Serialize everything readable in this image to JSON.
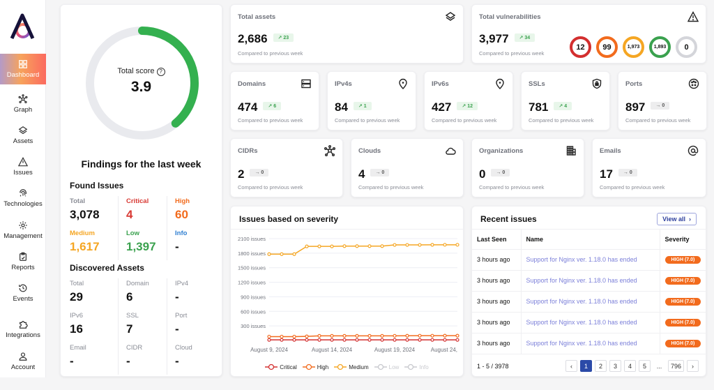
{
  "sidebar": {
    "items": [
      {
        "label": "Dashboard",
        "icon": "dashboard-icon",
        "active": true
      },
      {
        "label": "Graph",
        "icon": "graph-icon"
      },
      {
        "label": "Assets",
        "icon": "layers-icon"
      },
      {
        "label": "Issues",
        "icon": "warning-icon"
      },
      {
        "label": "Technologies",
        "icon": "fingerprint-icon"
      },
      {
        "label": "Management",
        "icon": "gear-icon"
      },
      {
        "label": "Reports",
        "icon": "clipboard-icon"
      },
      {
        "label": "Events",
        "icon": "history-icon"
      },
      {
        "label": "Integrations",
        "icon": "puzzle-icon"
      },
      {
        "label": "Account",
        "icon": "user-icon"
      }
    ]
  },
  "score": {
    "label": "Total score",
    "value": "3.9",
    "fraction": 0.39,
    "color": "#34b04f"
  },
  "findings": {
    "title": "Findings for the last week",
    "found_issues": {
      "title": "Found Issues",
      "cells": [
        {
          "label": "Total",
          "value": "3,078",
          "color": "#8a8d96",
          "valcolor": "#111111"
        },
        {
          "label": "Critical",
          "value": "4",
          "color": "#d83a34",
          "valcolor": "#d83a34"
        },
        {
          "label": "High",
          "value": "60",
          "color": "#f26b1d",
          "valcolor": "#f26b1d"
        },
        {
          "label": "Medium",
          "value": "1,617",
          "color": "#f5a623",
          "valcolor": "#f5a623"
        },
        {
          "label": "Low",
          "value": "1,397",
          "color": "#3aa14e",
          "valcolor": "#3aa14e"
        },
        {
          "label": "Info",
          "value": "-",
          "color": "#2f7fd1",
          "valcolor": "#111111"
        }
      ]
    },
    "discovered_assets": {
      "title": "Discovered Assets",
      "cells": [
        {
          "label": "Total",
          "value": "29"
        },
        {
          "label": "Domain",
          "value": "6"
        },
        {
          "label": "IPv4",
          "value": "-"
        },
        {
          "label": "IPv6",
          "value": "16"
        },
        {
          "label": "SSL",
          "value": "7"
        },
        {
          "label": "Port",
          "value": "-"
        },
        {
          "label": "Email",
          "value": "-"
        },
        {
          "label": "CIDR",
          "value": "-"
        },
        {
          "label": "Cloud",
          "value": "-"
        }
      ]
    }
  },
  "compare_text": "Compared to previous week",
  "total_assets": {
    "title": "Total assets",
    "value": "2,686",
    "delta": "23",
    "trend": "up",
    "icon": "layers-icon"
  },
  "total_vulns": {
    "title": "Total vulnerabilities",
    "value": "3,977",
    "delta": "34",
    "trend": "up",
    "icon": "warning-icon",
    "rings": [
      {
        "value": "12",
        "color": "#d32f2f",
        "severity": "critical"
      },
      {
        "value": "99",
        "color": "#f26b1d",
        "severity": "high"
      },
      {
        "value": "1,973",
        "color": "#f5a623",
        "severity": "medium"
      },
      {
        "value": "1,893",
        "color": "#3aa14e",
        "severity": "low"
      },
      {
        "value": "0",
        "color": "#d4d5da",
        "severity": "info"
      }
    ]
  },
  "stats_row1": [
    {
      "title": "Domains",
      "value": "474",
      "delta": "6",
      "trend": "up",
      "icon": "server-icon"
    },
    {
      "title": "IPv4s",
      "value": "84",
      "delta": "1",
      "trend": "up",
      "icon": "location-pin-icon"
    },
    {
      "title": "IPv6s",
      "value": "427",
      "delta": "12",
      "trend": "up",
      "icon": "location-pin-icon"
    },
    {
      "title": "SSLs",
      "value": "781",
      "delta": "4",
      "trend": "up",
      "icon": "shield-lock-icon"
    },
    {
      "title": "Ports",
      "value": "897",
      "delta": "0",
      "trend": "flat",
      "icon": "port-icon"
    }
  ],
  "stats_row2": [
    {
      "title": "CIDRs",
      "value": "2",
      "delta": "0",
      "trend": "flat",
      "icon": "network-icon"
    },
    {
      "title": "Clouds",
      "value": "4",
      "delta": "0",
      "trend": "flat",
      "icon": "cloud-icon"
    },
    {
      "title": "Organizations",
      "value": "0",
      "delta": "0",
      "trend": "flat",
      "icon": "building-icon"
    },
    {
      "title": "Emails",
      "value": "17",
      "delta": "0",
      "trend": "flat",
      "icon": "at-icon"
    }
  ],
  "severity_chart": {
    "title": "Issues based on severity"
  },
  "chart_data": {
    "type": "line",
    "title": "Issues based on severity",
    "xlabel": "",
    "ylabel": "",
    "ylim": [
      0,
      2100
    ],
    "y_ticks": [
      300,
      600,
      900,
      1200,
      1500,
      1800,
      2100
    ],
    "y_tick_suffix": " issues",
    "x": [
      "August 9, 2024",
      "August 10, 2024",
      "August 11, 2024",
      "August 12, 2024",
      "August 13, 2024",
      "August 14, 2024",
      "August 15, 2024",
      "August 16, 2024",
      "August 17, 2024",
      "August 18, 2024",
      "August 19, 2024",
      "August 20, 2024",
      "August 21, 2024",
      "August 22, 2024",
      "August 23, 2024",
      "August 24, 2024"
    ],
    "x_tick_labels": [
      "August 9, 2024",
      "August 14, 2024",
      "August 19, 2024",
      "August 24,"
    ],
    "x_tick_indices": [
      0,
      5,
      10,
      15
    ],
    "grid": true,
    "legend_position": "bottom",
    "series": [
      {
        "name": "Critical",
        "color": "#d32f2f",
        "enabled": true,
        "values": [
          12,
          12,
          12,
          12,
          12,
          12,
          12,
          12,
          12,
          12,
          12,
          12,
          12,
          12,
          12,
          12
        ]
      },
      {
        "name": "High",
        "color": "#f26b1d",
        "enabled": true,
        "values": [
          80,
          80,
          80,
          85,
          95,
          95,
          95,
          95,
          95,
          95,
          96,
          97,
          98,
          98,
          99,
          99
        ]
      },
      {
        "name": "Medium",
        "color": "#f5a623",
        "enabled": true,
        "values": [
          1780,
          1780,
          1780,
          1940,
          1940,
          1940,
          1945,
          1945,
          1945,
          1945,
          1970,
          1970,
          1970,
          1972,
          1973,
          1973
        ]
      },
      {
        "name": "Low",
        "color": "#c8c9ce",
        "enabled": false,
        "values": []
      },
      {
        "name": "Info",
        "color": "#c8c9ce",
        "enabled": false,
        "values": []
      }
    ]
  },
  "recent_issues": {
    "title": "Recent issues",
    "view_all": "View all",
    "columns": [
      "Last Seen",
      "Name",
      "Severity"
    ],
    "rows": [
      {
        "last_seen": "3 hours ago",
        "name": "Support for Nginx ver. 1.18.0 has ended",
        "severity": "HIGH (7.0)"
      },
      {
        "last_seen": "3 hours ago",
        "name": "Support for Nginx ver. 1.18.0 has ended",
        "severity": "HIGH (7.0)"
      },
      {
        "last_seen": "3 hours ago",
        "name": "Support for Nginx ver. 1.18.0 has ended",
        "severity": "HIGH (7.0)"
      },
      {
        "last_seen": "3 hours ago",
        "name": "Support for Nginx ver. 1.18.0 has ended",
        "severity": "HIGH (7.0)"
      },
      {
        "last_seen": "3 hours ago",
        "name": "Support for Nginx ver. 1.18.0 has ended",
        "severity": "HIGH (7.0)"
      }
    ],
    "range": "1 - 5 / 3978",
    "pages": [
      "1",
      "2",
      "3",
      "4",
      "5",
      "...",
      "796"
    ],
    "current_page": "1"
  }
}
